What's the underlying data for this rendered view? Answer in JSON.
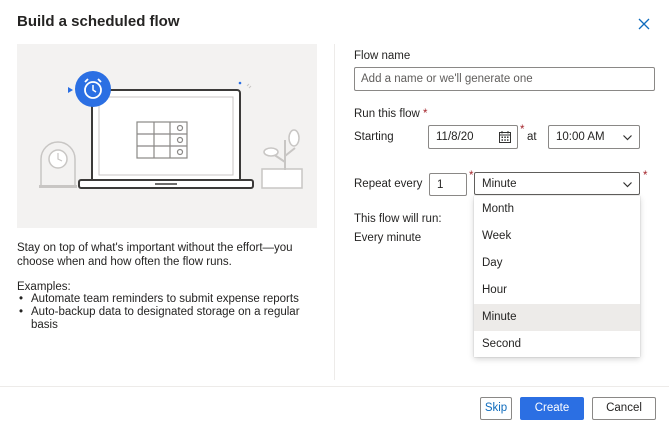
{
  "dialog": {
    "title": "Build a scheduled flow",
    "close_icon": "close-icon"
  },
  "left": {
    "illustration_icons": [
      "alarm-clock-icon",
      "laptop-icon",
      "calendar-grid-icon",
      "mantel-clock-icon",
      "plant-icon"
    ],
    "description": "Stay on top of what's important without the effort—you choose when and how often the flow runs.",
    "examples_heading": "Examples:",
    "examples": [
      "Automate team reminders to submit expense reports",
      "Auto-backup data to designated storage on a regular basis"
    ]
  },
  "form": {
    "flow_name_label": "Flow name",
    "flow_name_placeholder": "Add a name or we'll generate one",
    "flow_name_value": "",
    "run_label": "Run this flow",
    "required_mark": "*",
    "starting_label": "Starting",
    "start_date": "11/8/20",
    "date_icon": "calendar-icon",
    "at_label": "at",
    "start_time": "10:00 AM",
    "repeat_label": "Repeat every",
    "repeat_interval": "1",
    "repeat_unit": "Minute",
    "summary_label": "This flow will run:",
    "summary_value": "Every minute"
  },
  "unit_options": [
    {
      "label": "Month",
      "selected": false
    },
    {
      "label": "Week",
      "selected": false
    },
    {
      "label": "Day",
      "selected": false
    },
    {
      "label": "Hour",
      "selected": false
    },
    {
      "label": "Minute",
      "selected": true
    },
    {
      "label": "Second",
      "selected": false
    }
  ],
  "footer": {
    "skip_label": "Skip",
    "create_label": "Create",
    "cancel_label": "Cancel"
  },
  "colors": {
    "accent": "#2b6fe3",
    "required": "#a4262c",
    "illustration_bg": "#f3f2f1"
  }
}
